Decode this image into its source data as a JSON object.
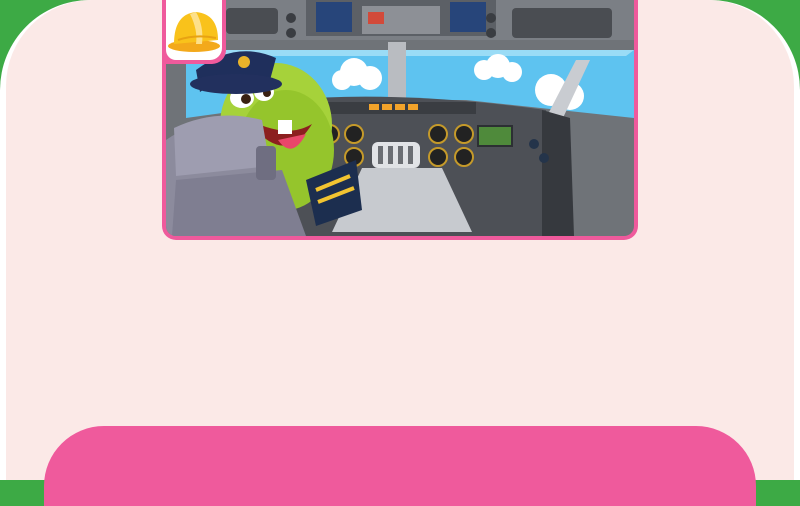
{
  "scene": {
    "icon": "hard-hat-icon",
    "character": "monster-pilot",
    "setting": "airplane-cockpit"
  },
  "colors": {
    "frame_outer": "#3daa45",
    "panel_bg": "#fbe9e7",
    "accent_pink": "#ef5a9c",
    "hat_yellow": "#f9c21b",
    "sky": "#5ec3f0"
  },
  "bottom_bar": {
    "label": ""
  }
}
